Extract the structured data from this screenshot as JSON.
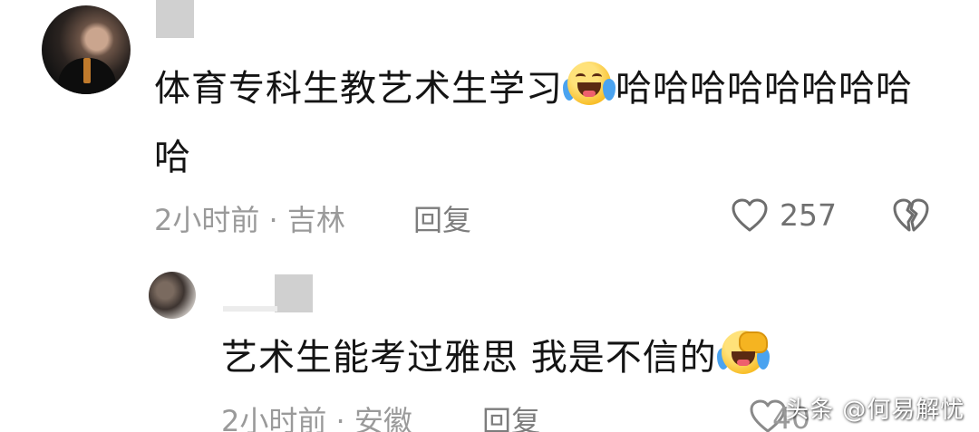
{
  "main_comment": {
    "text_part1": "体育专科生教艺术生学习",
    "emoji": "laughing-crying-emoji",
    "text_part2": "哈哈哈哈哈哈哈哈",
    "text_line2": "哈",
    "time": "2小时前",
    "separator": "·",
    "location": "吉林",
    "reply_label": "回复",
    "like_count": "257"
  },
  "reply_comment": {
    "text_part1": "艺术生能考过雅思 我是不信的",
    "emoji": "laughing-crying-emoji",
    "time": "2小时前",
    "separator": "·",
    "location": "安徽",
    "reply_label": "回复",
    "like_count": "40"
  },
  "watermark": "头条 @何易解忧",
  "colors": {
    "text": "#141414",
    "meta": "#9a9a9a",
    "icon_stroke": "#6e6e6e",
    "emoji_yellow": "#f7b81b",
    "tear_blue": "#4aa3f0"
  }
}
